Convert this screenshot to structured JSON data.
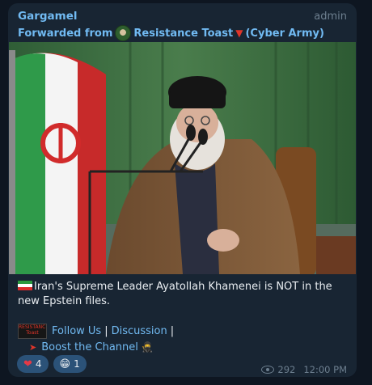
{
  "message": {
    "sender": "Gargamel",
    "badge": "admin",
    "forwarded_prefix": "Forwarded from",
    "forwarded_channel": "Resistance Toast",
    "forwarded_suffix": "(Cyber Army)",
    "caption_line": "Iran's Supreme Leader Ayatollah Khamenei is NOT in the new Epstein files.",
    "links": {
      "logo_text": "RESISTANCE Toast",
      "follow_us": "Follow Us",
      "sep1": "|",
      "discussion": "Discussion",
      "sep2": "|",
      "boost": "Boost the Channel"
    },
    "reactions": [
      {
        "emoji_icon": "heart-icon",
        "emoji": "❤",
        "count": "4"
      },
      {
        "emoji_icon": "grin-icon",
        "emoji": "😁",
        "count": "1"
      }
    ],
    "views": "292",
    "time": "12:00 PM"
  },
  "colors": {
    "background": "#0e1621",
    "bubble": "#182533",
    "link": "#71baf2",
    "text": "#e9edf1",
    "meta": "#6d7f8f"
  }
}
